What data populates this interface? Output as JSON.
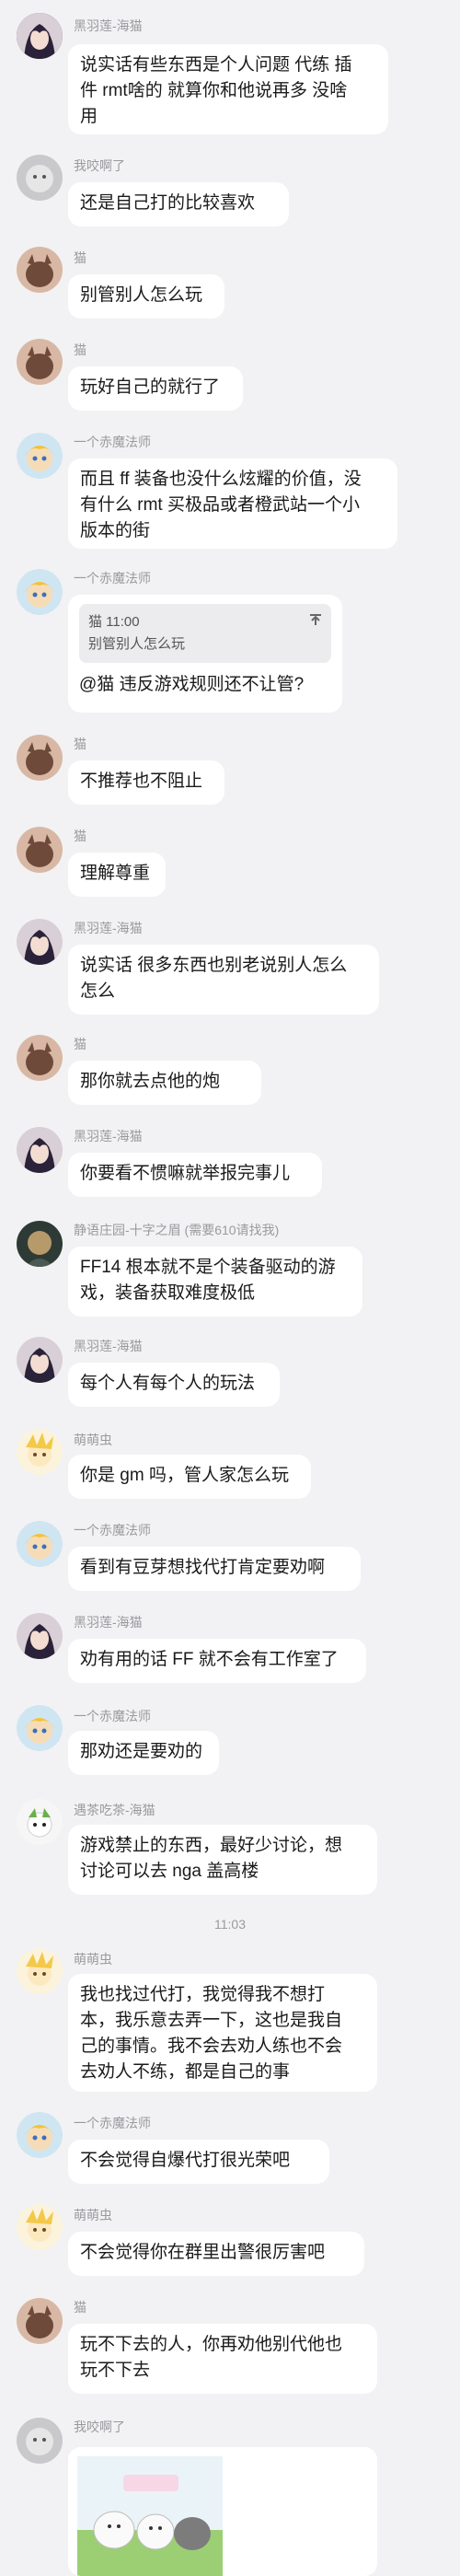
{
  "timestamp": "11:03",
  "messages": [
    {
      "name": "黑羽莲-海猫",
      "lines": [
        "说实话有些东西是个人问题 代练 插",
        "件 rmt啥的 就算你和他说再多 没啥",
        "用"
      ]
    },
    {
      "name": "我咬啊了",
      "lines": [
        "还是自己打的比较喜欢"
      ]
    },
    {
      "name": "猫",
      "lines": [
        "别管别人怎么玩"
      ]
    },
    {
      "name": "猫",
      "lines": [
        "玩好自己的就行了"
      ]
    },
    {
      "name": "一个赤魔法师",
      "lines": [
        "而且 ff 装备也没什么炫耀的价值，没",
        "有什么 rmt 买极品或者橙武站一个小",
        "版本的街"
      ]
    },
    {
      "name": "一个赤魔法师",
      "quote_header": "猫 11:00",
      "quote_text": "别管别人怎么玩",
      "lines": [
        "@猫 违反游戏规则还不让管?"
      ]
    },
    {
      "name": "猫",
      "lines": [
        "不推荐也不阻止"
      ]
    },
    {
      "name": "猫",
      "lines": [
        "理解尊重"
      ]
    },
    {
      "name": "黑羽莲-海猫",
      "lines": [
        "说实话 很多东西也别老说别人怎么",
        "怎么"
      ]
    },
    {
      "name": "猫",
      "lines": [
        "那你就去点他的炮"
      ]
    },
    {
      "name": "黑羽莲-海猫",
      "lines": [
        "你要看不惯嘛就举报完事儿"
      ]
    },
    {
      "name": "静语庄园-十字之眉 (需要610请找我)",
      "lines": [
        "FF14 根本就不是个装备驱动的游",
        "戏，装备获取难度极低"
      ]
    },
    {
      "name": "黑羽莲-海猫",
      "lines": [
        "每个人有每个人的玩法"
      ]
    },
    {
      "name": "萌萌虫",
      "lines": [
        "你是 gm 吗，管人家怎么玩"
      ]
    },
    {
      "name": "一个赤魔法师",
      "lines": [
        "看到有豆芽想找代打肯定要劝啊"
      ]
    },
    {
      "name": "黑羽莲-海猫",
      "lines": [
        "劝有用的话 FF 就不会有工作室了"
      ]
    },
    {
      "name": "一个赤魔法师",
      "lines": [
        "那劝还是要劝的"
      ]
    },
    {
      "name": "遇茶吃茶-海猫",
      "lines": [
        "游戏禁止的东西，最好少讨论，想",
        "讨论可以去 nga 盖高楼"
      ]
    },
    {
      "name": "萌萌虫",
      "lines": [
        "我也找过代打，我觉得我不想打",
        "本，我乐意去弄一下，这也是我自",
        "己的事情。我不会去劝人练也不会",
        "去劝人不练，都是自己的事"
      ]
    },
    {
      "name": "一个赤魔法师",
      "lines": [
        "不会觉得自爆代打很光荣吧"
      ]
    },
    {
      "name": "萌萌虫",
      "lines": [
        "不会觉得你在群里出警很厉害吧"
      ]
    },
    {
      "name": "猫",
      "lines": [
        "玩不下去的人，你再劝他别代他也",
        "玩不下去"
      ]
    },
    {
      "name": "我咬啊了",
      "lines": []
    }
  ],
  "colors": {
    "background": "#f2f2f4",
    "bubble": "#ffffff",
    "name": "#9a9a9e"
  }
}
